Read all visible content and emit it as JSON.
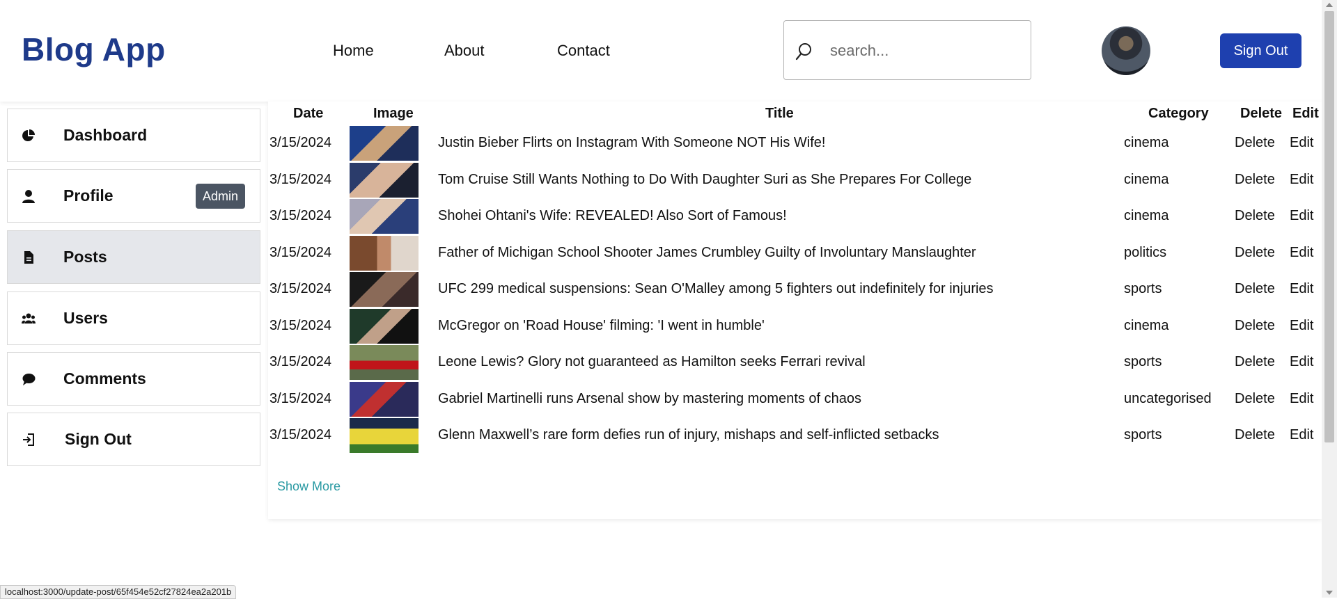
{
  "header": {
    "logo": "Blog App",
    "nav": [
      {
        "label": "Home"
      },
      {
        "label": "About"
      },
      {
        "label": "Contact"
      }
    ],
    "search_placeholder": "search...",
    "sign_out_label": "Sign Out"
  },
  "sidebar": {
    "items": [
      {
        "label": "Dashboard",
        "icon": "pie-chart-icon"
      },
      {
        "label": "Profile",
        "icon": "user-icon",
        "badge": "Admin"
      },
      {
        "label": "Posts",
        "icon": "document-icon",
        "active": true
      },
      {
        "label": "Users",
        "icon": "users-icon"
      },
      {
        "label": "Comments",
        "icon": "comment-icon"
      },
      {
        "label": "Sign Out",
        "icon": "sign-out-icon"
      }
    ]
  },
  "table": {
    "headers": [
      "Date",
      "Image",
      "Title",
      "Category",
      "Delete",
      "Edit"
    ],
    "rows": [
      {
        "date": "3/15/2024",
        "title": "Justin Bieber Flirts on Instagram With Someone NOT His Wife!",
        "category": "cinema",
        "delete": "Delete",
        "edit": "Edit"
      },
      {
        "date": "3/15/2024",
        "title": "Tom Cruise Still Wants Nothing to Do With Daughter Suri as She Prepares For College",
        "category": "cinema",
        "delete": "Delete",
        "edit": "Edit"
      },
      {
        "date": "3/15/2024",
        "title": "Shohei Ohtani's Wife: REVEALED! Also Sort of Famous!",
        "category": "cinema",
        "delete": "Delete",
        "edit": "Edit"
      },
      {
        "date": "3/15/2024",
        "title": "Father of Michigan School Shooter James Crumbley Guilty of Involuntary Manslaughter",
        "category": "politics",
        "delete": "Delete",
        "edit": "Edit"
      },
      {
        "date": "3/15/2024",
        "title": "UFC 299 medical suspensions: Sean O'Malley among 5 fighters out indefinitely for injuries",
        "category": "sports",
        "delete": "Delete",
        "edit": "Edit"
      },
      {
        "date": "3/15/2024",
        "title": "McGregor on 'Road House' filming: 'I went in humble'",
        "category": "cinema",
        "delete": "Delete",
        "edit": "Edit"
      },
      {
        "date": "3/15/2024",
        "title": "Leone Lewis? Glory not guaranteed as Hamilton seeks Ferrari revival",
        "category": "sports",
        "delete": "Delete",
        "edit": "Edit"
      },
      {
        "date": "3/15/2024",
        "title": "Gabriel Martinelli runs Arsenal show by mastering moments of chaos",
        "category": "uncategorised",
        "delete": "Delete",
        "edit": "Edit"
      },
      {
        "date": "3/15/2024",
        "title": "Glenn Maxwell’s rare form defies run of injury, mishaps and self-inflicted setbacks",
        "category": "sports",
        "delete": "Delete",
        "edit": "Edit"
      }
    ],
    "show_more": "Show More"
  },
  "status_bar": {
    "url": "localhost:3000/update-post/65f454e52cf27824ea2a201b"
  },
  "colors": {
    "brand": "#1e3a8a",
    "button": "#1e40af",
    "link": "#2a9aa3",
    "badge": "#4b5563"
  }
}
